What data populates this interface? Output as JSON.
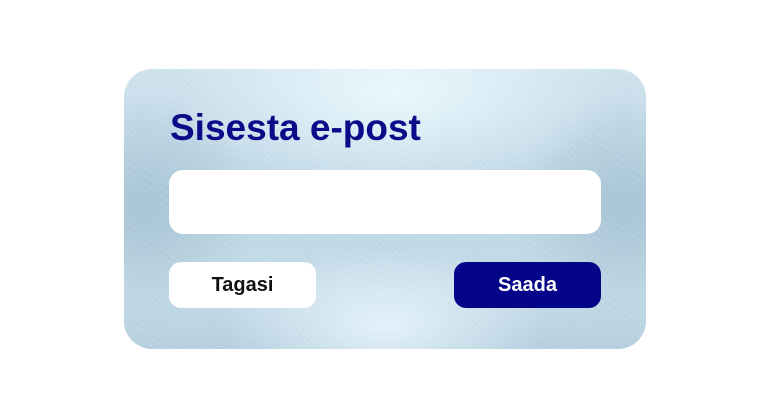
{
  "dialog": {
    "title": "Sisesta e-post",
    "email_value": "",
    "email_placeholder": ""
  },
  "buttons": {
    "back_label": "Tagasi",
    "send_label": "Saada"
  },
  "colors": {
    "title": "#0b0b8a",
    "send_button_bg": "#05058a",
    "send_button_text": "#ffffff",
    "back_button_bg": "#ffffff",
    "back_button_text": "#111111",
    "input_bg": "#ffffff"
  }
}
